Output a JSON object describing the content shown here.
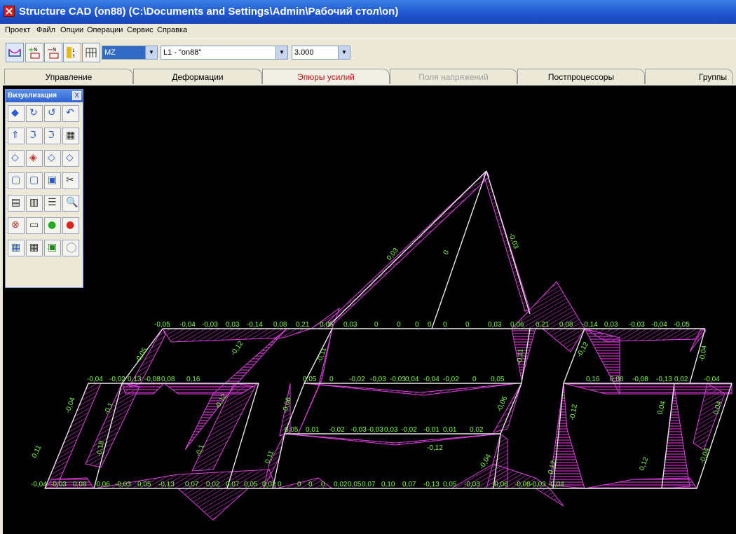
{
  "window": {
    "title": "Structure CAD (on88) (C:\\Documents and Settings\\Admin\\Рабочий стол\\on)"
  },
  "menu": [
    "Проект",
    "Файл",
    "Опции",
    "Операции",
    "Сервис",
    "Справка"
  ],
  "toolbar": {
    "factor_select": "MZ",
    "load_select": "L1 - \"on88\"",
    "scale_select": "3.000",
    "icons": [
      "diagram-icon",
      "add-node-icon",
      "remove-node-icon",
      "numbering-icon",
      "grid-icon"
    ]
  },
  "tabs": [
    {
      "label": "Управление",
      "state": "normal"
    },
    {
      "label": "Деформации",
      "state": "normal"
    },
    {
      "label": "Эпюры усилий",
      "state": "active"
    },
    {
      "label": "Поля напряжений",
      "state": "disabled"
    },
    {
      "label": "Постпроцессоры",
      "state": "normal"
    },
    {
      "label": "Группы",
      "state": "normal"
    }
  ],
  "palette": {
    "title": "Визуализация",
    "close": "X"
  },
  "drawing": {
    "row_top_labels": [
      "-0,05",
      "-0,04",
      "-0,03",
      "0,03",
      "-0,14",
      "0,08",
      "0,21",
      "0,06",
      "0,03",
      "0",
      "0",
      "0",
      "0",
      "0",
      "0",
      "0,03",
      "0,06",
      "0,21",
      "0,08",
      "-0,14",
      "0,03",
      "-0,03",
      "-0,04",
      "-0,05"
    ],
    "row_mid_labels": [
      "-0,04",
      "-0,02",
      "0,13",
      "-0,08",
      "0,08",
      "0,16",
      "0,05",
      "0",
      "-0,02",
      "-0,03",
      "-0,03",
      "0,04",
      "-0,04",
      "-0,02",
      "0",
      "0,05",
      "0,16",
      "0,08",
      "-0,08",
      "-0,13",
      "0,02",
      "-0,04"
    ],
    "row_low_labels": [
      "0,05",
      "0,01",
      "-0,02",
      "-0,03",
      "-0,03",
      "0,03",
      "-0,02",
      "-0,01",
      "0,01",
      "0,02"
    ],
    "row_bottom_labels": [
      "-0,04",
      "-0,03",
      "0,08",
      "-0,06",
      "-0,03",
      "0,05",
      "-0,13",
      "0,07",
      "0,02",
      "0,07",
      "0,05",
      "0,02",
      "0",
      "0",
      "0",
      "0",
      "0,02",
      "0,05",
      "0,07",
      "0,10",
      "0,07",
      "-0,13",
      "0,05",
      "-0,03",
      "-0,06",
      "-0,08",
      "-0,03",
      "-0,04"
    ],
    "diagonal_labels": [
      "0,03",
      "0",
      "-0,03",
      "-0,05",
      "-0,12",
      "-0,11",
      "-0,11",
      "-0,12",
      "-0,04",
      "-0,1",
      "-0,12",
      "-0,06",
      "-0,06",
      "-0,12",
      "0,04",
      "-0,04",
      "0,11",
      "-0,18",
      "-0,1",
      "0,11",
      "-0,04",
      "0,12",
      "0,12",
      "-0,04",
      "0,04",
      "-0,12"
    ]
  }
}
